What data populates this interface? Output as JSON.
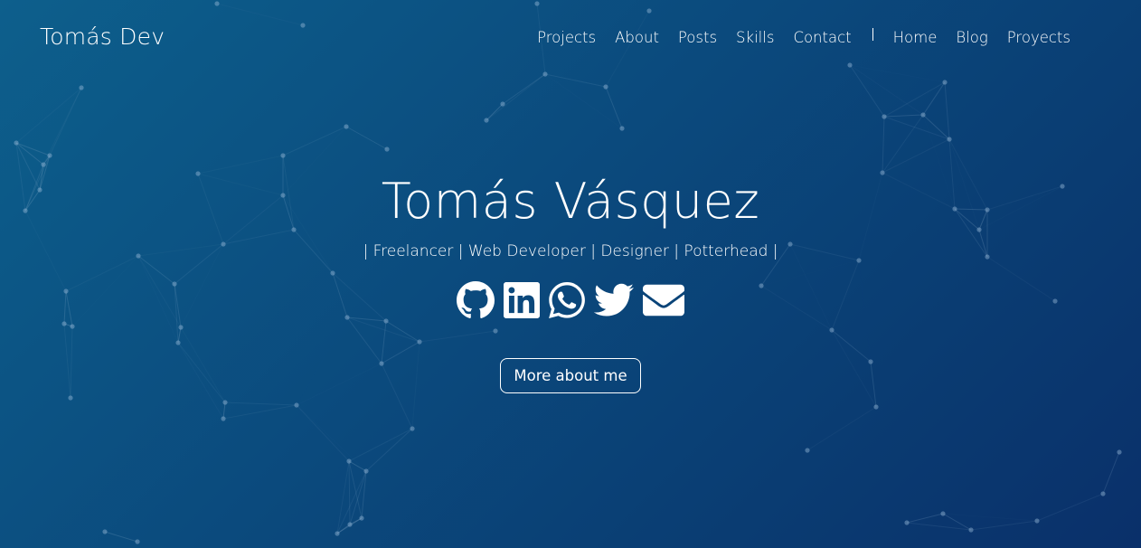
{
  "brand": "Tomás Dev",
  "nav": {
    "items": [
      "Projects",
      "About",
      "Posts",
      "Skills",
      "Contact"
    ],
    "secondary_items": [
      "Home",
      "Blog",
      "Proyects"
    ]
  },
  "hero": {
    "name": "Tomás Vásquez",
    "tagline": "| Freelancer | Web Developer | Designer | Potterhead |",
    "button_label": "More about me"
  },
  "social_icons": [
    "github-icon",
    "linkedin-icon",
    "whatsapp-icon",
    "twitter-icon",
    "email-icon"
  ],
  "colors": {
    "background_start": "#0d5f8c",
    "background_end": "#0a306a",
    "text": "#ffffff"
  }
}
